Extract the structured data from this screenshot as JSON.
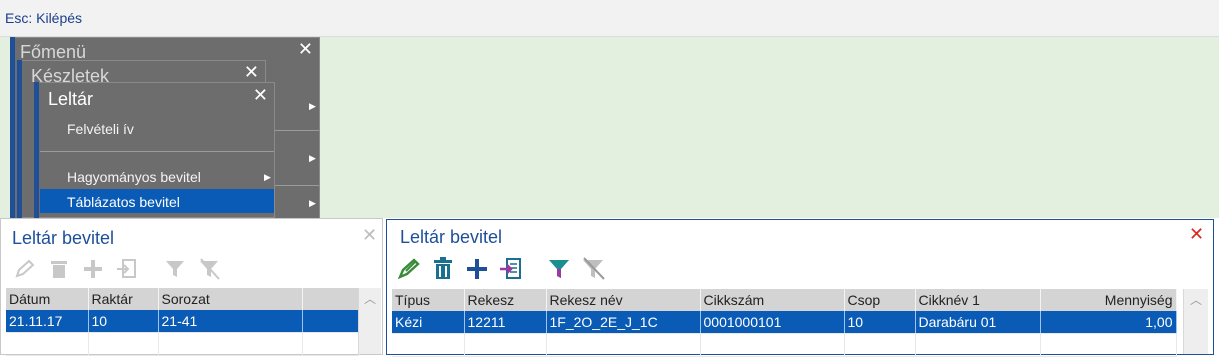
{
  "topbar": {
    "esc_label": "Esc: Kilépés"
  },
  "menus": {
    "main": {
      "title": "Főmenü",
      "close": "✕"
    },
    "stock": {
      "title": "Készletek",
      "close": "✕"
    },
    "inventory": {
      "title": "Leltár",
      "close": "✕",
      "items": [
        "Felvételi ív",
        "Hagyományos bevitel",
        "Táblázatos bevitel"
      ]
    }
  },
  "left_panel": {
    "title": "Leltár bevitel",
    "close": "✕",
    "columns": [
      "Dátum",
      "Raktár",
      "Sorozat",
      ""
    ],
    "rows": [
      [
        "21.11.17",
        "10",
        "21-41",
        ""
      ]
    ]
  },
  "right_panel": {
    "title": "Leltár bevitel",
    "close": "✕",
    "columns": [
      "Típus",
      "Rekesz",
      "Rekesz név",
      "Cikkszám",
      "Csop",
      "Cikknév 1",
      "Mennyiség"
    ],
    "rows": [
      [
        "Kézi",
        "12211",
        "1F_2O_2E_J_1C",
        "0001000101",
        "10",
        "Darabáru 01",
        "1,00"
      ]
    ]
  },
  "icons": {
    "edit": "pencil-icon",
    "delete": "trash-icon",
    "add": "plus-icon",
    "import": "import-icon",
    "filter": "filter-icon",
    "clear_filter": "clear-filter-icon"
  },
  "colors": {
    "accent": "#1e4f99",
    "selection": "#0a5bb5",
    "background_green": "#e4f0df",
    "close_red": "#d9281e"
  }
}
